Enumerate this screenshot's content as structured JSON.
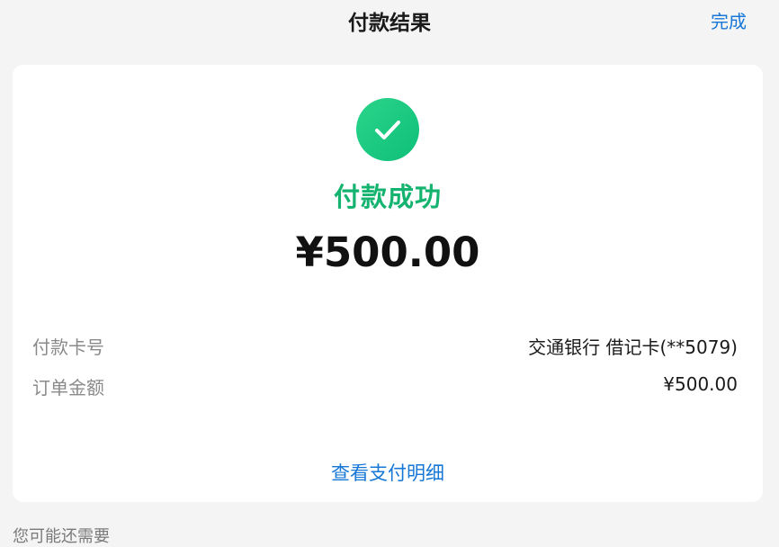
{
  "header": {
    "title": "付款结果",
    "done_label": "完成"
  },
  "result": {
    "status_text": "付款成功",
    "amount": "¥500.00",
    "status_color": "#14b36f",
    "icon": "check-icon"
  },
  "details": [
    {
      "label": "付款卡号",
      "value": "交通银行 借记卡(**5079)"
    },
    {
      "label": "订单金额",
      "value": "¥500.00"
    }
  ],
  "view_detail_label": "查看支付明细",
  "more_section_label": "您可能还需要",
  "colors": {
    "accent_blue": "#1677d6",
    "success_green": "#14b36f"
  }
}
